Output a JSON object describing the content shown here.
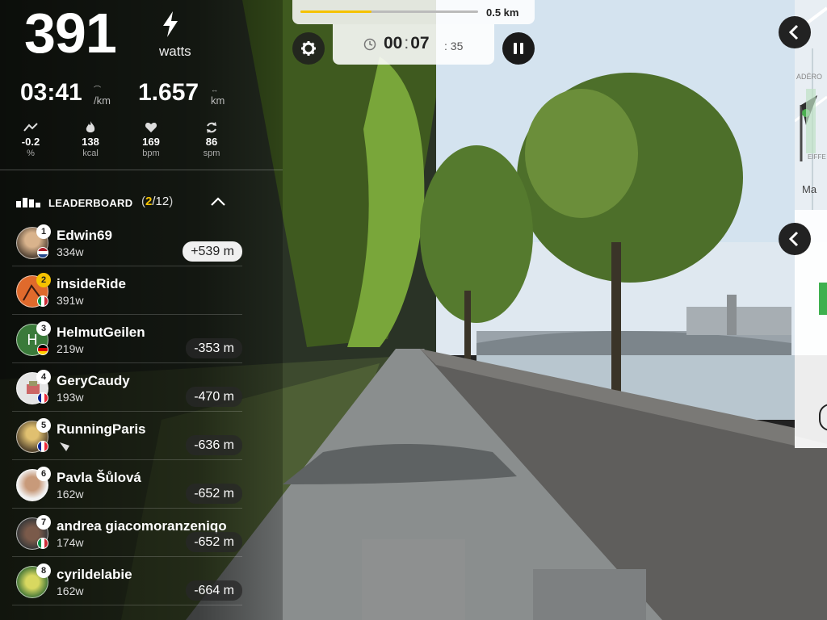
{
  "metrics": {
    "power_value": "391",
    "power_unit": "watts",
    "pace_value": "03:41",
    "pace_unit": "/km",
    "distance_value": "1.657",
    "distance_unit": "km",
    "small": [
      {
        "icon": "grade-icon",
        "value": "-0.2",
        "unit": "%"
      },
      {
        "icon": "flame-icon",
        "value": "138",
        "unit": "kcal"
      },
      {
        "icon": "heart-icon",
        "value": "169",
        "unit": "bpm"
      },
      {
        "icon": "cadence-icon",
        "value": "86",
        "unit": "spm"
      }
    ]
  },
  "leaderboard": {
    "title": "LEADERBOARD",
    "open_paren": "(",
    "rank": "2",
    "total": "/12",
    "close_paren": ")",
    "rows": [
      {
        "pos": "1",
        "name": "Edwin69",
        "watts": "334w",
        "gap": "+539 m",
        "flag": "nl"
      },
      {
        "pos": "2",
        "name": "insideRide",
        "watts": "391w",
        "gap": "",
        "flag": "it"
      },
      {
        "pos": "3",
        "name": "HelmutGeilen",
        "watts": "219w",
        "gap": "-353 m",
        "flag": "de",
        "initial": "H"
      },
      {
        "pos": "4",
        "name": "GeryCaudy",
        "watts": "193w",
        "gap": "-470 m",
        "flag": "fr"
      },
      {
        "pos": "5",
        "name": "RunningParis",
        "watts": "",
        "gap": "-636 m",
        "flag": "fr"
      },
      {
        "pos": "6",
        "name": "Pavla Šůlová",
        "watts": "162w",
        "gap": "-652 m",
        "flag": ""
      },
      {
        "pos": "7",
        "name": "andrea giacomoranzeniqo",
        "watts": "174w",
        "gap": "-652 m",
        "flag": "it"
      },
      {
        "pos": "8",
        "name": "cyrildelabie",
        "watts": "162w",
        "gap": "-664 m",
        "flag": ""
      }
    ]
  },
  "route": {
    "progress_fraction": 0.4,
    "progress_label": "0.5 km"
  },
  "timer": {
    "hours": "00",
    "minutes": "07",
    "seconds": "35"
  },
  "map": {
    "label_1": "ADÉRO",
    "label_2": "EIFFE",
    "label_3": "Ma"
  },
  "colors": {
    "accent": "#f5c200",
    "panel_bg": "#000000"
  }
}
